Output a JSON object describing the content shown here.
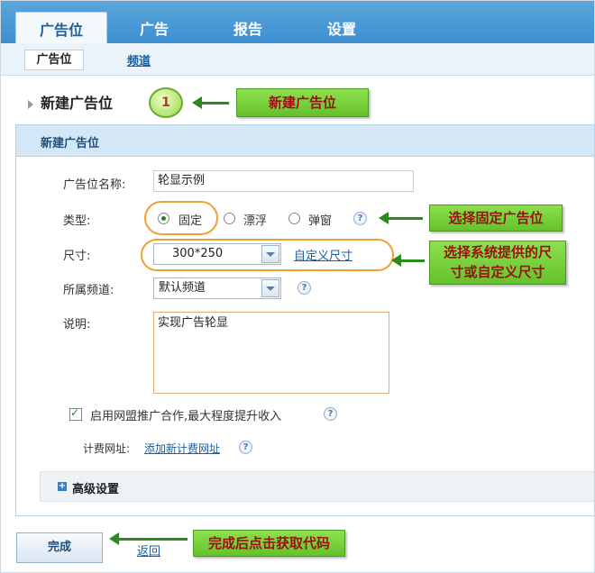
{
  "nav": {
    "tabs": [
      "广告位",
      "广告",
      "报告",
      "设置"
    ],
    "sub_tabs": [
      "广告位",
      "频道"
    ]
  },
  "heading": {
    "title": "新建广告位"
  },
  "annotations": {
    "step_number": "1",
    "callout_new": "新建广告位",
    "callout_fixed": "选择固定广告位",
    "callout_size_line1": "选择系统提供的尺",
    "callout_size_line2": "寸或自定义尺寸",
    "callout_done": "完成后点击获取代码"
  },
  "panel": {
    "title": "新建广告位",
    "name_label": "广告位名称:",
    "name_value": "轮显示例",
    "type_label": "类型:",
    "type_options": [
      "固定",
      "漂浮",
      "弹窗"
    ],
    "type_selected": "固定",
    "size_label": "尺寸:",
    "size_value": "300*250",
    "custom_size_link": "自定义尺寸",
    "channel_label": "所属频道:",
    "channel_value": "默认频道",
    "desc_label": "说明:",
    "desc_value": "实现广告轮显",
    "union_checkbox_label": "启用网盟推广合作,最大程度提升收入",
    "union_checked": true,
    "billing_label": "计费网址:",
    "billing_link": "添加新计费网址",
    "advanced_label": "高级设置",
    "help_glyph": "?"
  },
  "footer": {
    "done_label": "完成",
    "back_label": "返回"
  },
  "colors": {
    "nav_blue": "#3d8fd0",
    "callout_green": "#63c22b",
    "callout_text": "#9b1111",
    "highlight_orange": "#f0a030"
  }
}
